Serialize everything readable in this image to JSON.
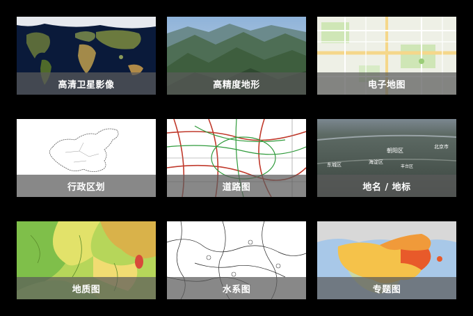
{
  "tiles": [
    {
      "label": "高清卫星影像"
    },
    {
      "label": "高精度地形"
    },
    {
      "label": "电子地图"
    },
    {
      "label": "行政区划"
    },
    {
      "label": "道路图"
    },
    {
      "label": "地名 / 地标"
    },
    {
      "label": "地质图"
    },
    {
      "label": "水系图"
    },
    {
      "label": "专题图"
    }
  ],
  "placenames": [
    "北京市",
    "朝阳区",
    "海淀区",
    "东城区",
    "丰台区"
  ],
  "colors": {
    "background": "#000000",
    "caption_overlay": "#5a5a5a",
    "caption_text": "#ffffff"
  }
}
